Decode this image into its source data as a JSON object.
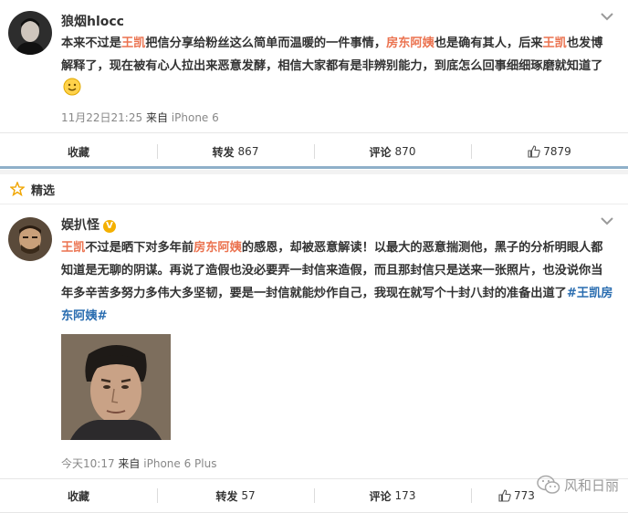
{
  "post1": {
    "username": "狼烟hlocc",
    "text_segments": [
      {
        "t": "本来不过是"
      },
      {
        "t": "王凯",
        "hl": true
      },
      {
        "t": "把信分享给粉丝这么简单而温暖的一件事情，"
      },
      {
        "t": "房东阿姨",
        "hl": true
      },
      {
        "t": "也是确有其人，后来"
      },
      {
        "t": "王凯",
        "hl": true
      },
      {
        "t": "也发博解释了，现在被有心人拉出来恶意发酵，相信大家都有是非辨别能力，到底怎么回事细细琢磨就知道了"
      }
    ],
    "time": "11月22日21:25",
    "source_prefix": "来自",
    "source": "iPhone 6",
    "actions": {
      "favorite": "收藏",
      "repost_label": "转发",
      "repost_count": "867",
      "comment_label": "评论",
      "comment_count": "870",
      "like_count": "7879"
    }
  },
  "section": {
    "label": "精选"
  },
  "post2": {
    "username": "娱扒怪",
    "verified_badge": "V",
    "text_segments": [
      {
        "t": "王凯",
        "hl": true
      },
      {
        "t": "不过是晒下对多年前"
      },
      {
        "t": "房东阿姨",
        "hl": true
      },
      {
        "t": "的感恩，却被恶意解读！以最大的恶意揣测他，黑子的分析明眼人都知道是无聊的阴谋。再说了造假也没必要弄一封信来造假，而且那封信只是送来一张照片，也没说你当年多辛苦多努力多伟大多坚韧，要是一封信就能炒作自己，我现在就写个十封八封的准备出道了"
      },
      {
        "t": "#王凯房东阿姨#",
        "tag": true
      }
    ],
    "time": "今天10:17",
    "source_prefix": "来自",
    "source": "iPhone 6 Plus",
    "actions": {
      "favorite": "收藏",
      "repost_label": "转发",
      "repost_count": "57",
      "comment_label": "评论",
      "comment_count": "173",
      "like_count": "773"
    }
  },
  "watermark": "风和日丽",
  "colors": {
    "highlight": "#eb7350",
    "hashtag": "#2a6db0",
    "meta": "#888888"
  }
}
